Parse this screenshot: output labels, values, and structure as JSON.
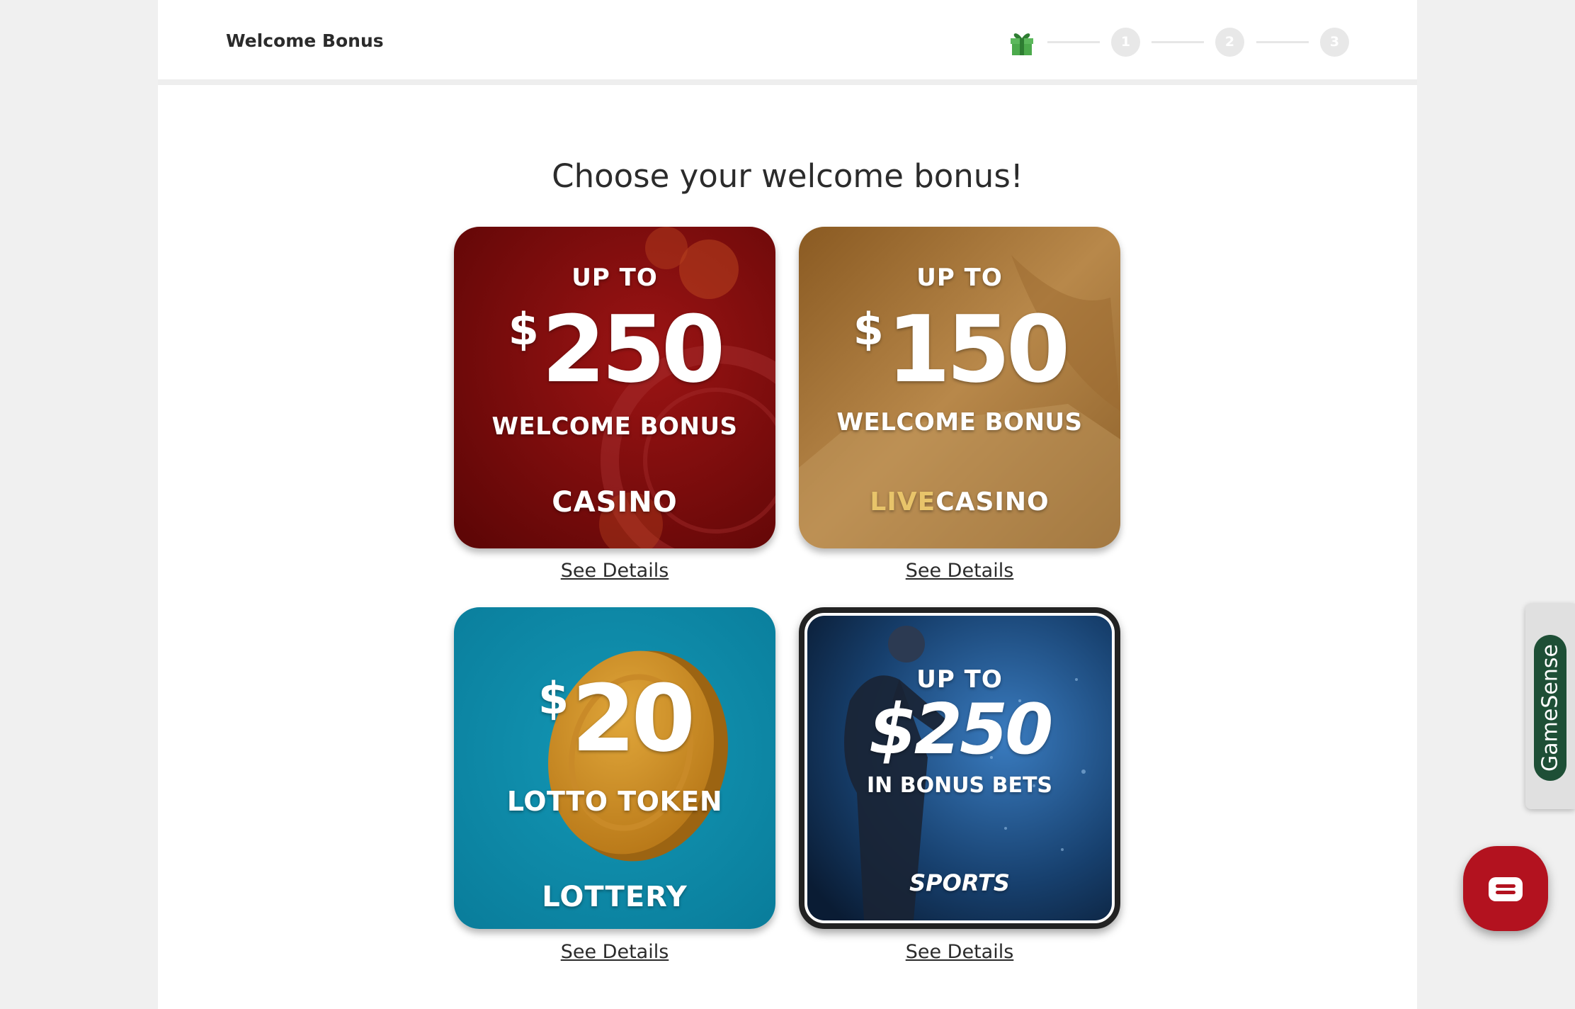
{
  "header": {
    "title": "Welcome Bonus",
    "steps": [
      "1",
      "2",
      "3"
    ],
    "gift_icon": "gift-icon"
  },
  "main": {
    "heading": "Choose your welcome bonus!",
    "cards": [
      {
        "up_to": "UP TO",
        "dollar": "$",
        "amount": "250",
        "subtitle": "WELCOME BONUS",
        "product": "CASINO",
        "details_label": "See Details",
        "color": "#7a0a0a"
      },
      {
        "up_to": "UP TO",
        "dollar": "$",
        "amount": "150",
        "subtitle": "WELCOME BONUS",
        "product_prefix": "LIVE",
        "product": "CASINO",
        "details_label": "See Details",
        "color": "#a07232"
      },
      {
        "dollar": "$",
        "amount": "20",
        "subtitle": "LOTTO TOKEN",
        "product": "LOTTERY",
        "details_label": "See Details",
        "color": "#0d8aa8"
      },
      {
        "up_to": "UP TO",
        "amount": "$250",
        "subtitle": "IN BONUS BETS",
        "product": "SPORTS",
        "details_label": "See Details",
        "color": "#0f2a4a",
        "selected": true
      }
    ]
  },
  "widgets": {
    "gamesense_label": "GameSense",
    "chat_icon": "chat-icon"
  }
}
